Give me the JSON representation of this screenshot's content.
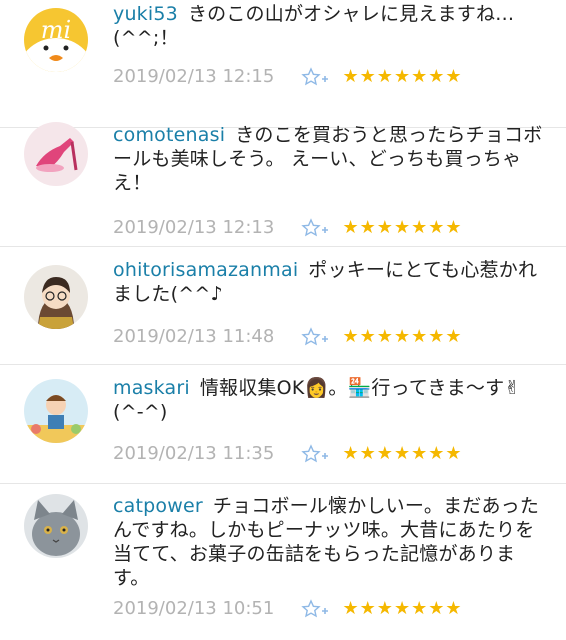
{
  "comments": [
    {
      "user": "yuki53",
      "text": "きのこの山がオシャレに見えますね…(^^;！",
      "date": "2019/02/13 12:15",
      "stars": "★★★★★★★",
      "avatar": "mi-chick-avatar"
    },
    {
      "user": "comotenasi",
      "text": "きのこを買おうと思ったらチョコボールも美味しそう。 えーい、どっちも買っちゃえ！",
      "date": "2019/02/13 12:13",
      "stars": "★★★★★★★",
      "avatar": "pink-heel-avatar"
    },
    {
      "user": "ohitorisamazanmai",
      "text": "ポッキーにとても心惹かれました(^^♪",
      "date": "2019/02/13 11:48",
      "stars": "★★★★★★★",
      "avatar": "glasses-girl-avatar"
    },
    {
      "user": "maskari",
      "text": "情報収集OK👩。🏪行ってきま〜す✌(^-^)",
      "date": "2019/02/13 11:35",
      "stars": "★★★★★★★",
      "avatar": "illustration-avatar"
    },
    {
      "user": "catpower",
      "text": "チョコボール懐かしいー。まだあったんですね。しかもピーナッツ味。大昔にあたりを当てて、お菓子の缶詰をもらった記憶があります。",
      "date": "2019/02/13 10:51",
      "stars": "★★★★★★★",
      "avatar": "gray-cat-avatar"
    }
  ],
  "colors": {
    "username": "#1a7fa8",
    "star": "#f5b800",
    "date": "#b3b3b3",
    "fav_icon": "#8fb9e6"
  }
}
